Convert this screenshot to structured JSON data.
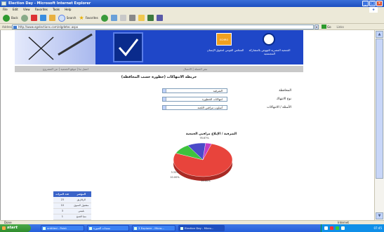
{
  "window": {
    "title": "Election Day - Microsoft Internet Explorer"
  },
  "menu": [
    "File",
    "Edit",
    "View",
    "Favorites",
    "Tools",
    "Help"
  ],
  "toolbar": {
    "back": "Back",
    "search": "Search",
    "favorites": "Favorites"
  },
  "address": {
    "label": "Address",
    "url": "http://www.egelections.com/elgdetec.aspx",
    "go": "Go",
    "links": "Links"
  },
  "banner": {
    "org_left": "المجلس القومي لحقوق الإنسان",
    "org_right": "الجمعية المصرية للنهوض بالمشاركة المجتمعية",
    "logo_text": "ECHRO"
  },
  "subnav": {
    "left": "اتصل بنا | موقع الجمعية | عن المشروع",
    "right": "مقر الحملة | الاتصال"
  },
  "page": {
    "title": "خريطة الانتهاكات (خطورة حسب المحافظة)"
  },
  "form": {
    "rows": [
      {
        "label": "المحافظة",
        "value": "الشرقية"
      },
      {
        "label": "نوع الانتهاك",
        "value": "انتهاكات الخطورة"
      },
      {
        "label": "الأسئلة / الانتهاكات",
        "value": "أسلوب مراقبي اللجنة"
      }
    ]
  },
  "chart_data": {
    "type": "pie",
    "title": "الشرقية / الإبلاغ مراقبي الجمعية",
    "slices": [
      {
        "label": "",
        "value": 76.67,
        "label_text": "76.67%",
        "color": "#e8443c"
      },
      {
        "label": "",
        "value": 10.0,
        "label_text": "10.00%",
        "color": "#3ec23e"
      },
      {
        "label": "",
        "value": 10.0,
        "label_text": "10.00%",
        "color": "#4a4ac8"
      },
      {
        "label": "",
        "value": 3.33,
        "label_text": "3.33%",
        "color": "#c33cc3"
      }
    ]
  },
  "legend_table": {
    "headers": [
      "المؤشر",
      "عدد المرات"
    ],
    "rows": [
      [
        "الزقازيق",
        "23"
      ],
      [
        "مشتول السوق",
        "10"
      ],
      [
        "بلبيس",
        "3"
      ],
      [
        "منيا القمح",
        "1"
      ]
    ]
  },
  "status": {
    "left": "Done",
    "zone": "Internet"
  },
  "taskbar": {
    "start": "start",
    "tasks": [
      "untitled - Paint",
      "منتجات الصورة",
      "3 Explorer - Micro...",
      "Election Day - Micro..."
    ],
    "clock": "07:45"
  },
  "colors": {
    "titlebar": "#1c4fc0",
    "banner": "#1f47c8",
    "pie_main": "#e8443c"
  }
}
